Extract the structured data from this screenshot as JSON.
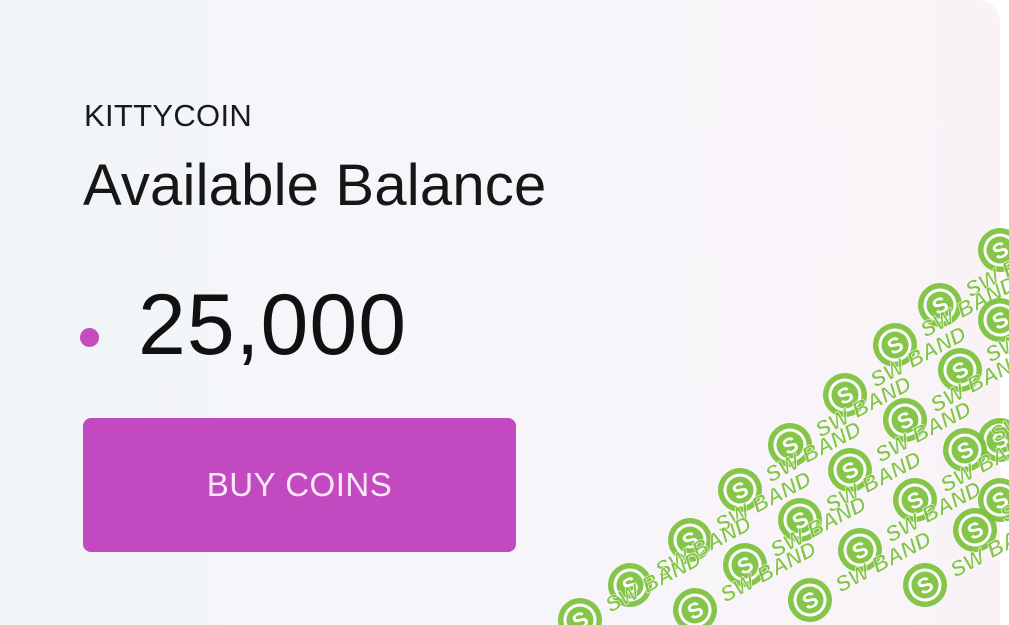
{
  "card": {
    "brand_label": "KITTYCOIN",
    "title": "Available Balance",
    "balance": "25,000",
    "coin_icon": "coin-dot-icon",
    "buy_button_label": "BUY COINS"
  },
  "watermark": {
    "text": "SW BAND",
    "logo_letter": "S"
  },
  "colors": {
    "accent": "#c349c1",
    "coin_dot": "#c44cbf",
    "watermark_green": "#7cc23b"
  }
}
